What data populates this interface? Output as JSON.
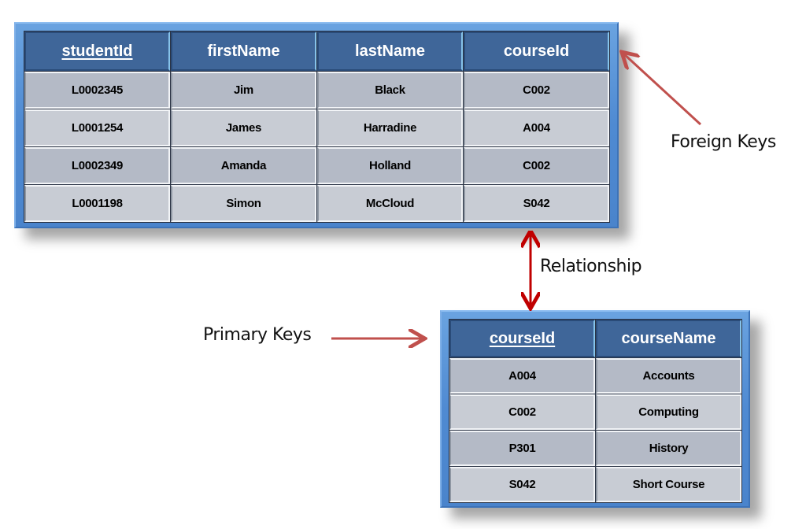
{
  "students_table": {
    "columns": [
      {
        "label": "studentId",
        "primary_key": true
      },
      {
        "label": "firstName",
        "primary_key": false
      },
      {
        "label": "lastName",
        "primary_key": false
      },
      {
        "label": "courseId",
        "primary_key": false
      }
    ],
    "rows": [
      [
        "L0002345",
        "Jim",
        "Black",
        "C002"
      ],
      [
        "L0001254",
        "James",
        "Harradine",
        "A004"
      ],
      [
        "L0002349",
        "Amanda",
        "Holland",
        "C002"
      ],
      [
        "L0001198",
        "Simon",
        "McCloud",
        "S042"
      ]
    ]
  },
  "courses_table": {
    "columns": [
      {
        "label": "courseId",
        "primary_key": true
      },
      {
        "label": "courseName",
        "primary_key": false
      }
    ],
    "rows": [
      [
        "A004",
        "Accounts"
      ],
      [
        "C002",
        "Computing"
      ],
      [
        "P301",
        "History"
      ],
      [
        "S042",
        "Short Course"
      ]
    ]
  },
  "annotations": {
    "foreign_keys": "Foreign Keys",
    "relationship": "Relationship",
    "primary_keys": "Primary Keys"
  },
  "colors": {
    "frame_blue": "#4f8ad2",
    "header_blue": "#3f6699",
    "row_dark": "#b4bac6",
    "row_light": "#c8ccd4",
    "arrow_red": "#c0504d",
    "relationship_red": "#c00000"
  }
}
